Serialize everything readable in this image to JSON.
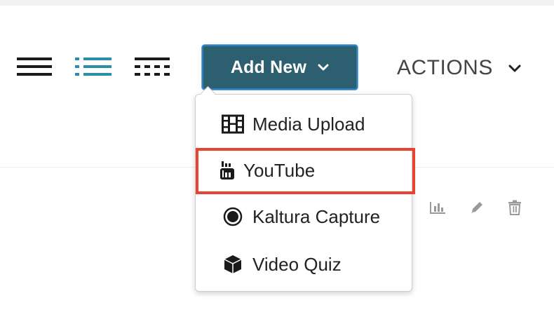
{
  "toolbar": {
    "add_new_label": "Add New",
    "actions_label": "ACTIONS",
    "view_icons": [
      "list-view-icon",
      "detailed-view-icon",
      "grid-view-icon"
    ]
  },
  "add_new_menu": {
    "items": [
      {
        "label": "Media Upload",
        "icon": "film-icon"
      },
      {
        "label": "YouTube",
        "icon": "youtube-icon"
      },
      {
        "label": "Kaltura Capture",
        "icon": "record-icon"
      },
      {
        "label": "Video Quiz",
        "icon": "cube-icon"
      }
    ],
    "highlighted_item": "YouTube"
  },
  "row_actions": [
    "stats-icon",
    "edit-icon",
    "delete-icon"
  ],
  "colors": {
    "button_bg": "#2c5f6f",
    "button_border": "#2f7fbf",
    "accent_teal": "#2a8fa8",
    "highlight": "#e8432e",
    "muted_icon": "#9a9a9a"
  }
}
